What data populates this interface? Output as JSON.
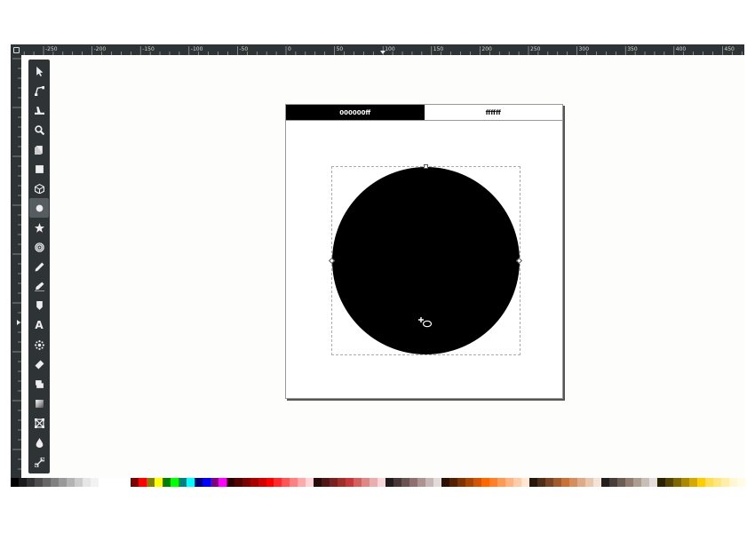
{
  "ruler_top": {
    "labels": [
      "-250",
      "-200",
      "-150",
      "-100",
      "-50",
      "0",
      "50",
      "100",
      "150",
      "200",
      "250",
      "300",
      "350",
      "400",
      "450"
    ]
  },
  "tools": [
    {
      "name": "selector-tool",
      "icon": "arrow-icon"
    },
    {
      "name": "node-tool",
      "icon": "node-icon"
    },
    {
      "name": "tweak-tool",
      "icon": "tweak-icon"
    },
    {
      "name": "zoom-tool",
      "icon": "zoom-icon"
    },
    {
      "name": "measure-tool",
      "icon": "measure-icon"
    },
    {
      "name": "rectangle-tool",
      "icon": "rectangle-icon"
    },
    {
      "name": "3d-box-tool",
      "icon": "cube-icon"
    },
    {
      "name": "ellipse-tool",
      "icon": "circle-icon",
      "active": true
    },
    {
      "name": "star-tool",
      "icon": "star-icon"
    },
    {
      "name": "spiral-tool",
      "icon": "spiral-icon"
    },
    {
      "name": "pencil-tool",
      "icon": "pencil-icon"
    },
    {
      "name": "pen-tool",
      "icon": "pen-icon"
    },
    {
      "name": "calligraphy-tool",
      "icon": "calligraphy-icon"
    },
    {
      "name": "text-tool",
      "icon": "text-icon",
      "glyph": "A"
    },
    {
      "name": "spray-tool",
      "icon": "spray-icon"
    },
    {
      "name": "eraser-tool",
      "icon": "eraser-icon"
    },
    {
      "name": "paint-bucket-tool",
      "icon": "bucket-icon"
    },
    {
      "name": "gradient-tool",
      "icon": "gradient-icon"
    },
    {
      "name": "mesh-tool",
      "icon": "mesh-icon"
    },
    {
      "name": "dropper-tool",
      "icon": "dropper-icon"
    },
    {
      "name": "connector-tool",
      "icon": "connector-icon"
    }
  ],
  "canvas": {
    "swatches": [
      {
        "label": "000000ff",
        "color": "#000000"
      },
      {
        "label": "ffffff",
        "color": "#ffffff"
      }
    ],
    "circle_fill": "#000000"
  },
  "palette": [
    "#000000",
    "#1a1a1a",
    "#333333",
    "#4d4d4d",
    "#666666",
    "#808080",
    "#999999",
    "#b3b3b3",
    "#cccccc",
    "#e6e6e6",
    "#f2f2f2",
    "#ffffff",
    "#ffffff",
    "#ffffff",
    "#ffffff",
    "#800000",
    "#ff0000",
    "#808000",
    "#ffff00",
    "#008000",
    "#00ff00",
    "#008080",
    "#00ffff",
    "#000080",
    "#0000ff",
    "#800080",
    "#ff00ff",
    "#2b0000",
    "#550000",
    "#800000",
    "#aa0000",
    "#d40000",
    "#ff0000",
    "#ff2a2a",
    "#ff5555",
    "#ff8080",
    "#ffaaaa",
    "#ffd5d5",
    "#280b0b",
    "#501616",
    "#782121",
    "#a02c2c",
    "#c83737",
    "#d35f5f",
    "#de8787",
    "#e9afaf",
    "#f4d7d7",
    "#241c1c",
    "#483737",
    "#6c5353",
    "#916f6f",
    "#ac9393",
    "#c8b7b7",
    "#e3dbdb",
    "#2b1100",
    "#552200",
    "#803300",
    "#aa4400",
    "#d45500",
    "#ff6600",
    "#ff7f2a",
    "#ff9955",
    "#ffb380",
    "#ffccaa",
    "#ffe6d5",
    "#28170b",
    "#502d16",
    "#784421",
    "#a05a2c",
    "#c87137",
    "#d38d5f",
    "#deaa87",
    "#e9c6af",
    "#f4e3d7",
    "#241f1c",
    "#483e37",
    "#6c5d53",
    "#917c6f",
    "#ac9d93",
    "#c8beb7",
    "#e3dedb",
    "#2b2200",
    "#554400",
    "#806600",
    "#aa8800",
    "#d4aa00",
    "#ffcc00",
    "#ffdd55",
    "#ffe680",
    "#ffeeaa",
    "#fff6d5",
    "#fffbe6"
  ]
}
